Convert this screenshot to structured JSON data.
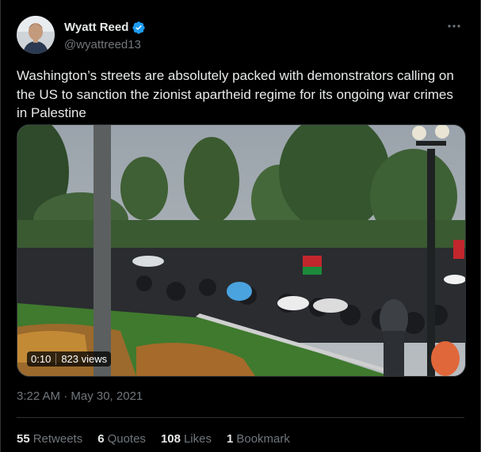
{
  "author": {
    "display_name": "Wyatt Reed",
    "handle": "@wyattreed13",
    "verified_icon": "verified-badge-icon",
    "avatar_icon": "avatar-photo"
  },
  "more_icon": "more-horizontal-icon",
  "tweet": {
    "text": "Washington’s streets are absolutely packed with demonstrators calling on the US to sanction the zionist apartheid regime for its ongoing war crimes in Palestine"
  },
  "video": {
    "duration": "0:10",
    "views": "823 views"
  },
  "timestamp": "3:22 AM · May 30, 2021",
  "stats": {
    "retweets_count": "55",
    "retweets_label": "Retweets",
    "quotes_count": "6",
    "quotes_label": "Quotes",
    "likes_count": "108",
    "likes_label": "Likes",
    "bookmarks_count": "1",
    "bookmarks_label": "Bookmark"
  },
  "colors": {
    "background": "#000000",
    "text": "#e7e9ea",
    "secondary": "#71767b",
    "verified": "#1d9bf0",
    "border": "#2f3336"
  }
}
